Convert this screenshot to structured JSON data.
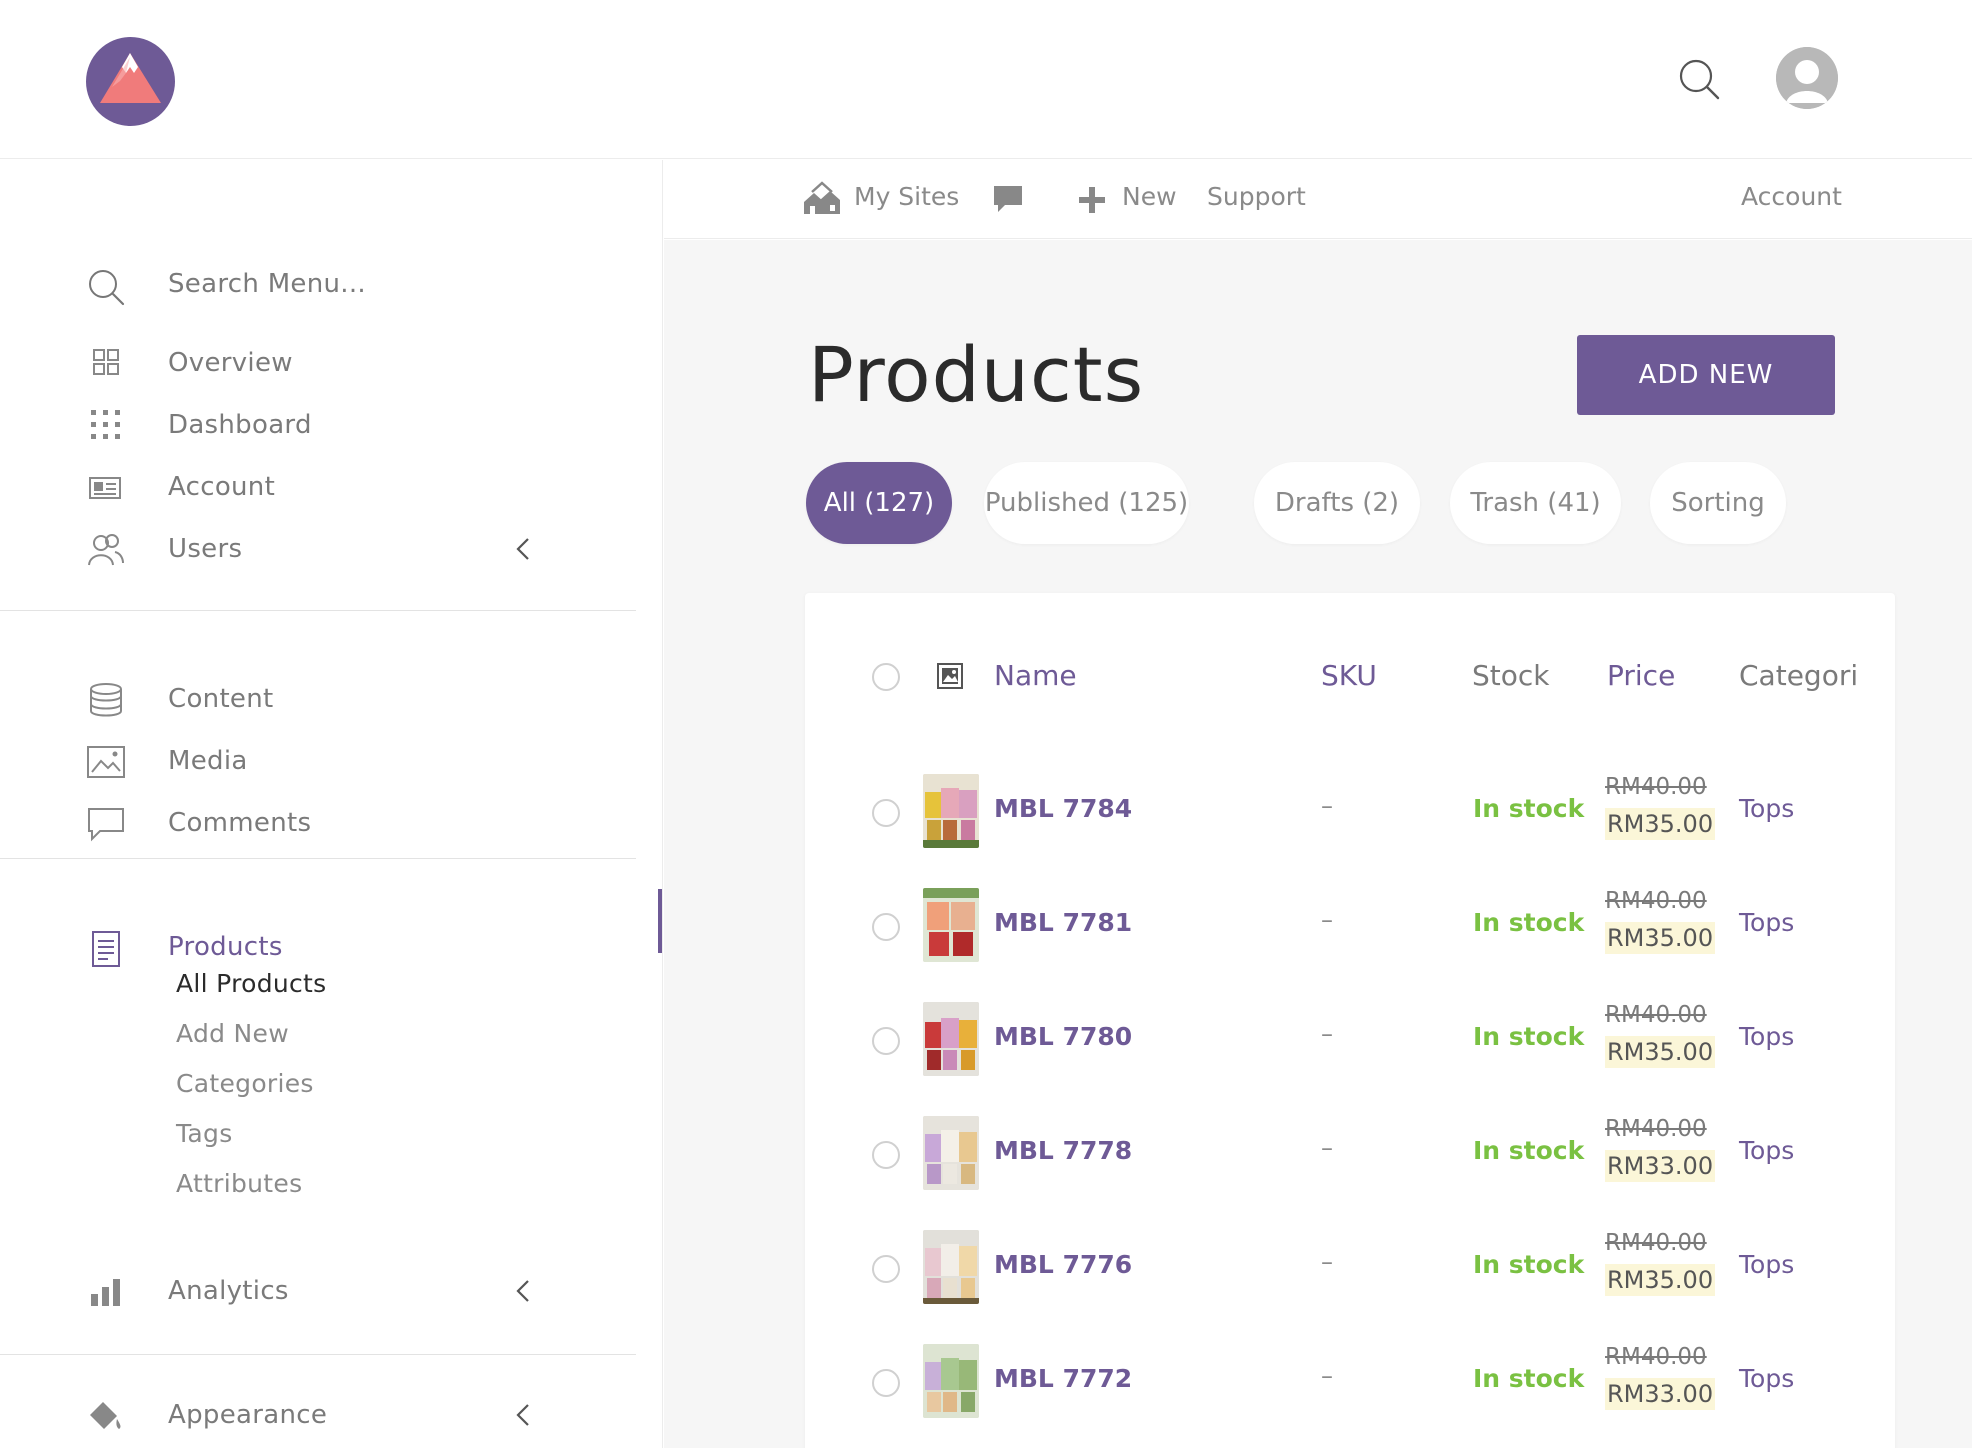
{
  "colors": {
    "accent": "#6e5a96",
    "in_stock": "#7ac142",
    "price_highlight": "#fbf6d8"
  },
  "header": {
    "logo_icon": "mountain-logo-icon",
    "search_icon": "search-icon",
    "avatar_icon": "user-avatar-icon"
  },
  "sidebar": {
    "search": {
      "placeholder": "Search Menu..."
    },
    "items": [
      {
        "label": "Overview",
        "icon": "overview-grid-icon"
      },
      {
        "label": "Dashboard",
        "icon": "dashboard-dots-icon"
      },
      {
        "label": "Account",
        "icon": "account-card-icon"
      },
      {
        "label": "Users",
        "icon": "users-icon"
      },
      {
        "label": "Content",
        "icon": "database-icon"
      },
      {
        "label": "Media",
        "icon": "image-icon"
      },
      {
        "label": "Comments",
        "icon": "comment-icon"
      },
      {
        "label": "Products",
        "icon": "document-icon"
      },
      {
        "label": "Analytics",
        "icon": "bar-chart-icon"
      },
      {
        "label": "Appearance",
        "icon": "paint-bucket-icon"
      }
    ],
    "products_sub": [
      "All Products",
      "Add New",
      "Categories",
      "Tags",
      "Attributes"
    ]
  },
  "adminbar": {
    "my_sites": "My Sites",
    "new": "New",
    "support": "Support",
    "account": "Account"
  },
  "page": {
    "title": "Products",
    "add_new": "ADD NEW",
    "filters": [
      "All (127)",
      "Published (125)",
      "Drafts (2)",
      "Trash (41)",
      "Sorting"
    ]
  },
  "table": {
    "columns": {
      "name": "Name",
      "sku": "SKU",
      "stock": "Stock",
      "price": "Price",
      "categories": "Categori"
    },
    "rows": [
      {
        "name": "MBL 7784",
        "sku": "–",
        "stock": "In stock",
        "old_price": "RM40.00",
        "price": "RM35.00",
        "category": "Tops"
      },
      {
        "name": "MBL 7781",
        "sku": "–",
        "stock": "In stock",
        "old_price": "RM40.00",
        "price": "RM35.00",
        "category": "Tops"
      },
      {
        "name": "MBL 7780",
        "sku": "–",
        "stock": "In stock",
        "old_price": "RM40.00",
        "price": "RM35.00",
        "category": "Tops"
      },
      {
        "name": "MBL 7778",
        "sku": "–",
        "stock": "In stock",
        "old_price": "RM40.00",
        "price": "RM33.00",
        "category": "Tops"
      },
      {
        "name": "MBL 7776",
        "sku": "–",
        "stock": "In stock",
        "old_price": "RM40.00",
        "price": "RM35.00",
        "category": "Tops"
      },
      {
        "name": "MBL 7772",
        "sku": "–",
        "stock": "In stock",
        "old_price": "RM40.00",
        "price": "RM33.00",
        "category": "Tops"
      }
    ]
  }
}
